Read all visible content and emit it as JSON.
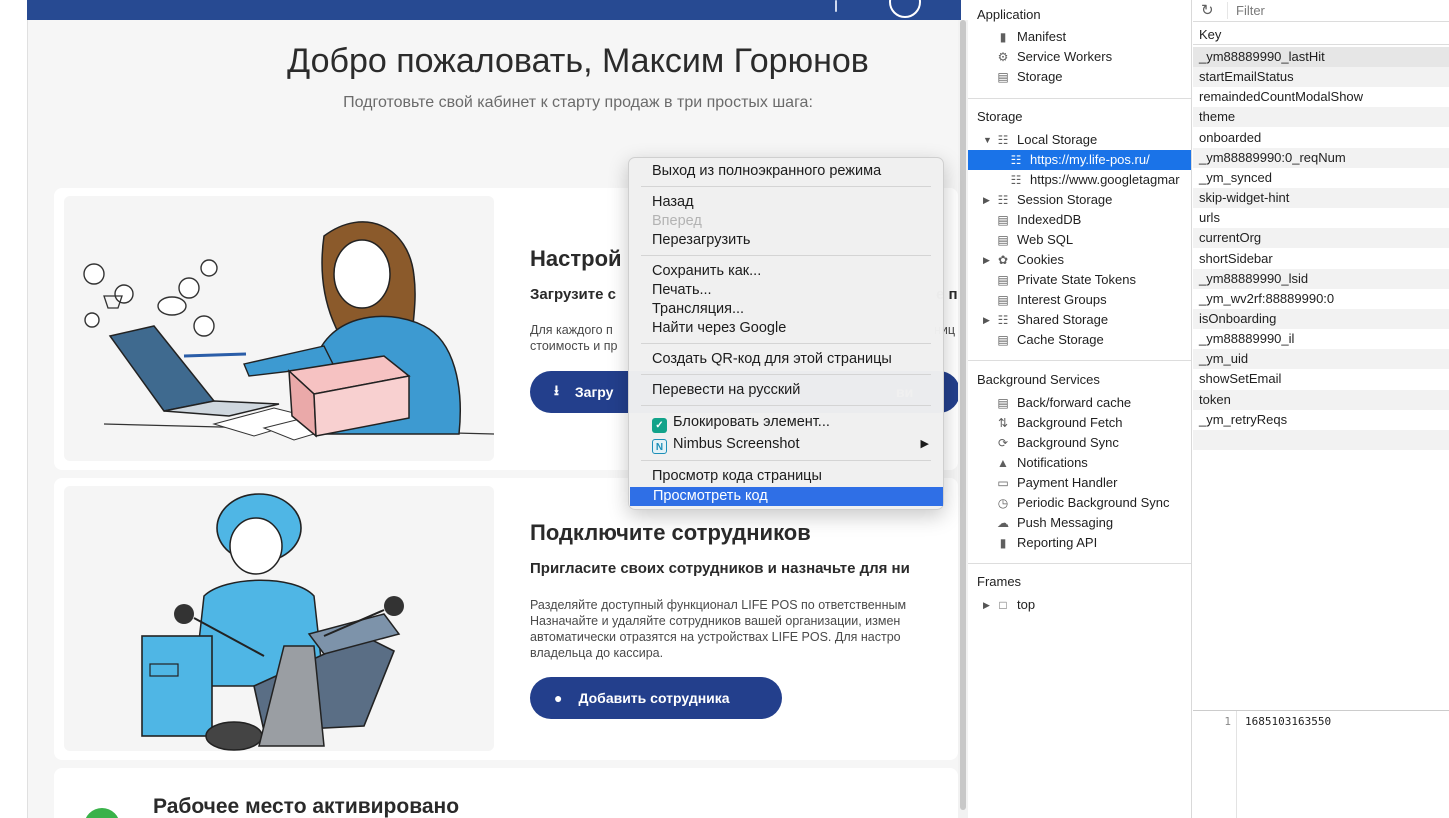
{
  "page": {
    "welcome_title": "Добро пожаловать, Максим Горюнов",
    "welcome_subtitle": "Подготовьте свой кабинет к старту продаж в три простых шага:",
    "card1": {
      "title": "Настрой",
      "strong": "Загрузите с",
      "strong_tail": "е п",
      "text_lines": [
        "Для каждого п",
        "стоимость и пр"
      ],
      "text_tails": [
        "ниц",
        ""
      ],
      "button_label": "Загру",
      "button_tail": "ви"
    },
    "card2": {
      "title": "Подключите сотрудников",
      "strong": "Пригласите своих сотрудников и назначьте для ни",
      "text_lines": [
        "Разделяйте доступный функционал LIFE POS по ответственным",
        "Назначайте и удаляйте сотрудников вашей организации, измен",
        "автоматически отразятся на устройствах LIFE POS. Для настро",
        "владельца до кассира."
      ],
      "button_label": "Добавить сотрудника"
    },
    "card3": {
      "title": "Рабочее место активировано"
    }
  },
  "context_menu": {
    "items": [
      {
        "label": "Выход из полноэкранного режима",
        "disabled": false
      },
      {
        "label": "Назад",
        "disabled": false
      },
      {
        "label": "Вперед",
        "disabled": true
      },
      {
        "label": "Перезагрузить",
        "disabled": false
      },
      {
        "label": "Сохранить как...",
        "disabled": false
      },
      {
        "label": "Печать...",
        "disabled": false
      },
      {
        "label": "Трансляция...",
        "disabled": false
      },
      {
        "label": "Найти через Google",
        "disabled": false
      },
      {
        "label": "Создать QR-код для этой страницы",
        "disabled": false
      },
      {
        "label": "Перевести на русский",
        "disabled": false
      },
      {
        "label": "Блокировать элемент...",
        "disabled": false
      },
      {
        "label": "Nimbus Screenshot",
        "disabled": false
      },
      {
        "label": "Просмотр кода страницы",
        "disabled": false
      },
      {
        "label": "Просмотреть код",
        "disabled": false,
        "selected": true
      }
    ]
  },
  "devtools": {
    "sections": {
      "application": "Application",
      "storage": "Storage",
      "background_services": "Background Services",
      "frames": "Frames"
    },
    "application_items": [
      "Manifest",
      "Service Workers",
      "Storage"
    ],
    "storage_items": [
      "Local Storage",
      "https://my.life-pos.ru/",
      "https://www.googletagmar",
      "Session Storage",
      "IndexedDB",
      "Web SQL",
      "Cookies",
      "Private State Tokens",
      "Interest Groups",
      "Shared Storage",
      "Cache Storage"
    ],
    "background_items": [
      "Back/forward cache",
      "Background Fetch",
      "Background Sync",
      "Notifications",
      "Payment Handler",
      "Periodic Background Sync",
      "Push Messaging",
      "Reporting API"
    ],
    "frames_items": [
      "top"
    ],
    "filter_placeholder": "Filter",
    "key_header": "Key",
    "keys": [
      "_ym88889990_lastHit",
      "startEmailStatus",
      "remaindedCountModalShow",
      "theme",
      "onboarded",
      "_ym88889990:0_reqNum",
      "_ym_synced",
      "skip-widget-hint",
      "urls",
      "currentOrg",
      "shortSidebar",
      "_ym88889990_lsid",
      "_ym_wv2rf:88889990:0",
      "isOnboarding",
      "_ym88889990_il",
      "_ym_uid",
      "showSetEmail",
      "token",
      "_ym_retryReqs"
    ],
    "value_line_number": "1",
    "value_text": "1685103163550"
  },
  "colors": {
    "brand_blue": "#233f8c",
    "topbar_blue": "#274a92",
    "selection_blue": "#1a73e8",
    "menu_highlight": "#2f6fe6"
  }
}
